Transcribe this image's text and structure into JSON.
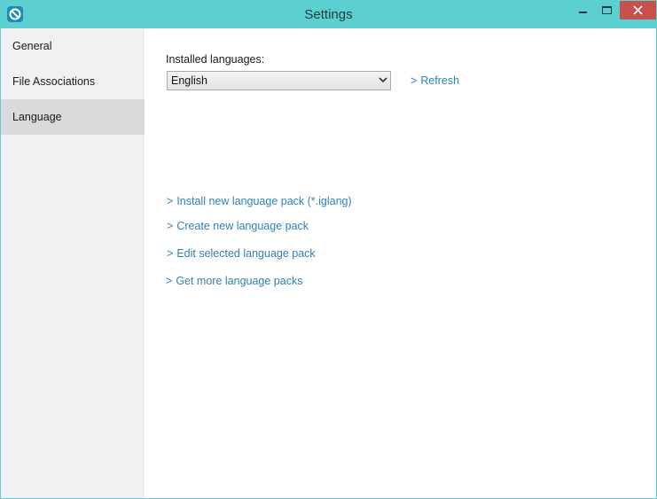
{
  "window": {
    "title": "Settings"
  },
  "sidebar": {
    "items": [
      {
        "label": "General",
        "selected": false
      },
      {
        "label": "File Associations",
        "selected": false
      },
      {
        "label": "Language",
        "selected": true
      }
    ]
  },
  "language": {
    "installed_label": "Installed languages:",
    "selected_language": "English",
    "refresh": "Refresh",
    "links": [
      "Install new language pack (*.iglang)",
      "Create new language pack",
      "Edit selected language pack",
      "Get more language packs"
    ]
  },
  "icons": {
    "app": "app-logo-icon",
    "minimize": "minimize-icon",
    "maximize": "maximize-icon",
    "close": "close-icon",
    "dropdown": "chevron-down-icon",
    "link_arrow": "chevron-right-icon"
  },
  "colors": {
    "titlebar": "#5ccfd0",
    "close_button": "#c7504c",
    "sidebar": "#f1f1f1",
    "sidebar_selected": "#dadada",
    "link": "#2f82b8"
  }
}
